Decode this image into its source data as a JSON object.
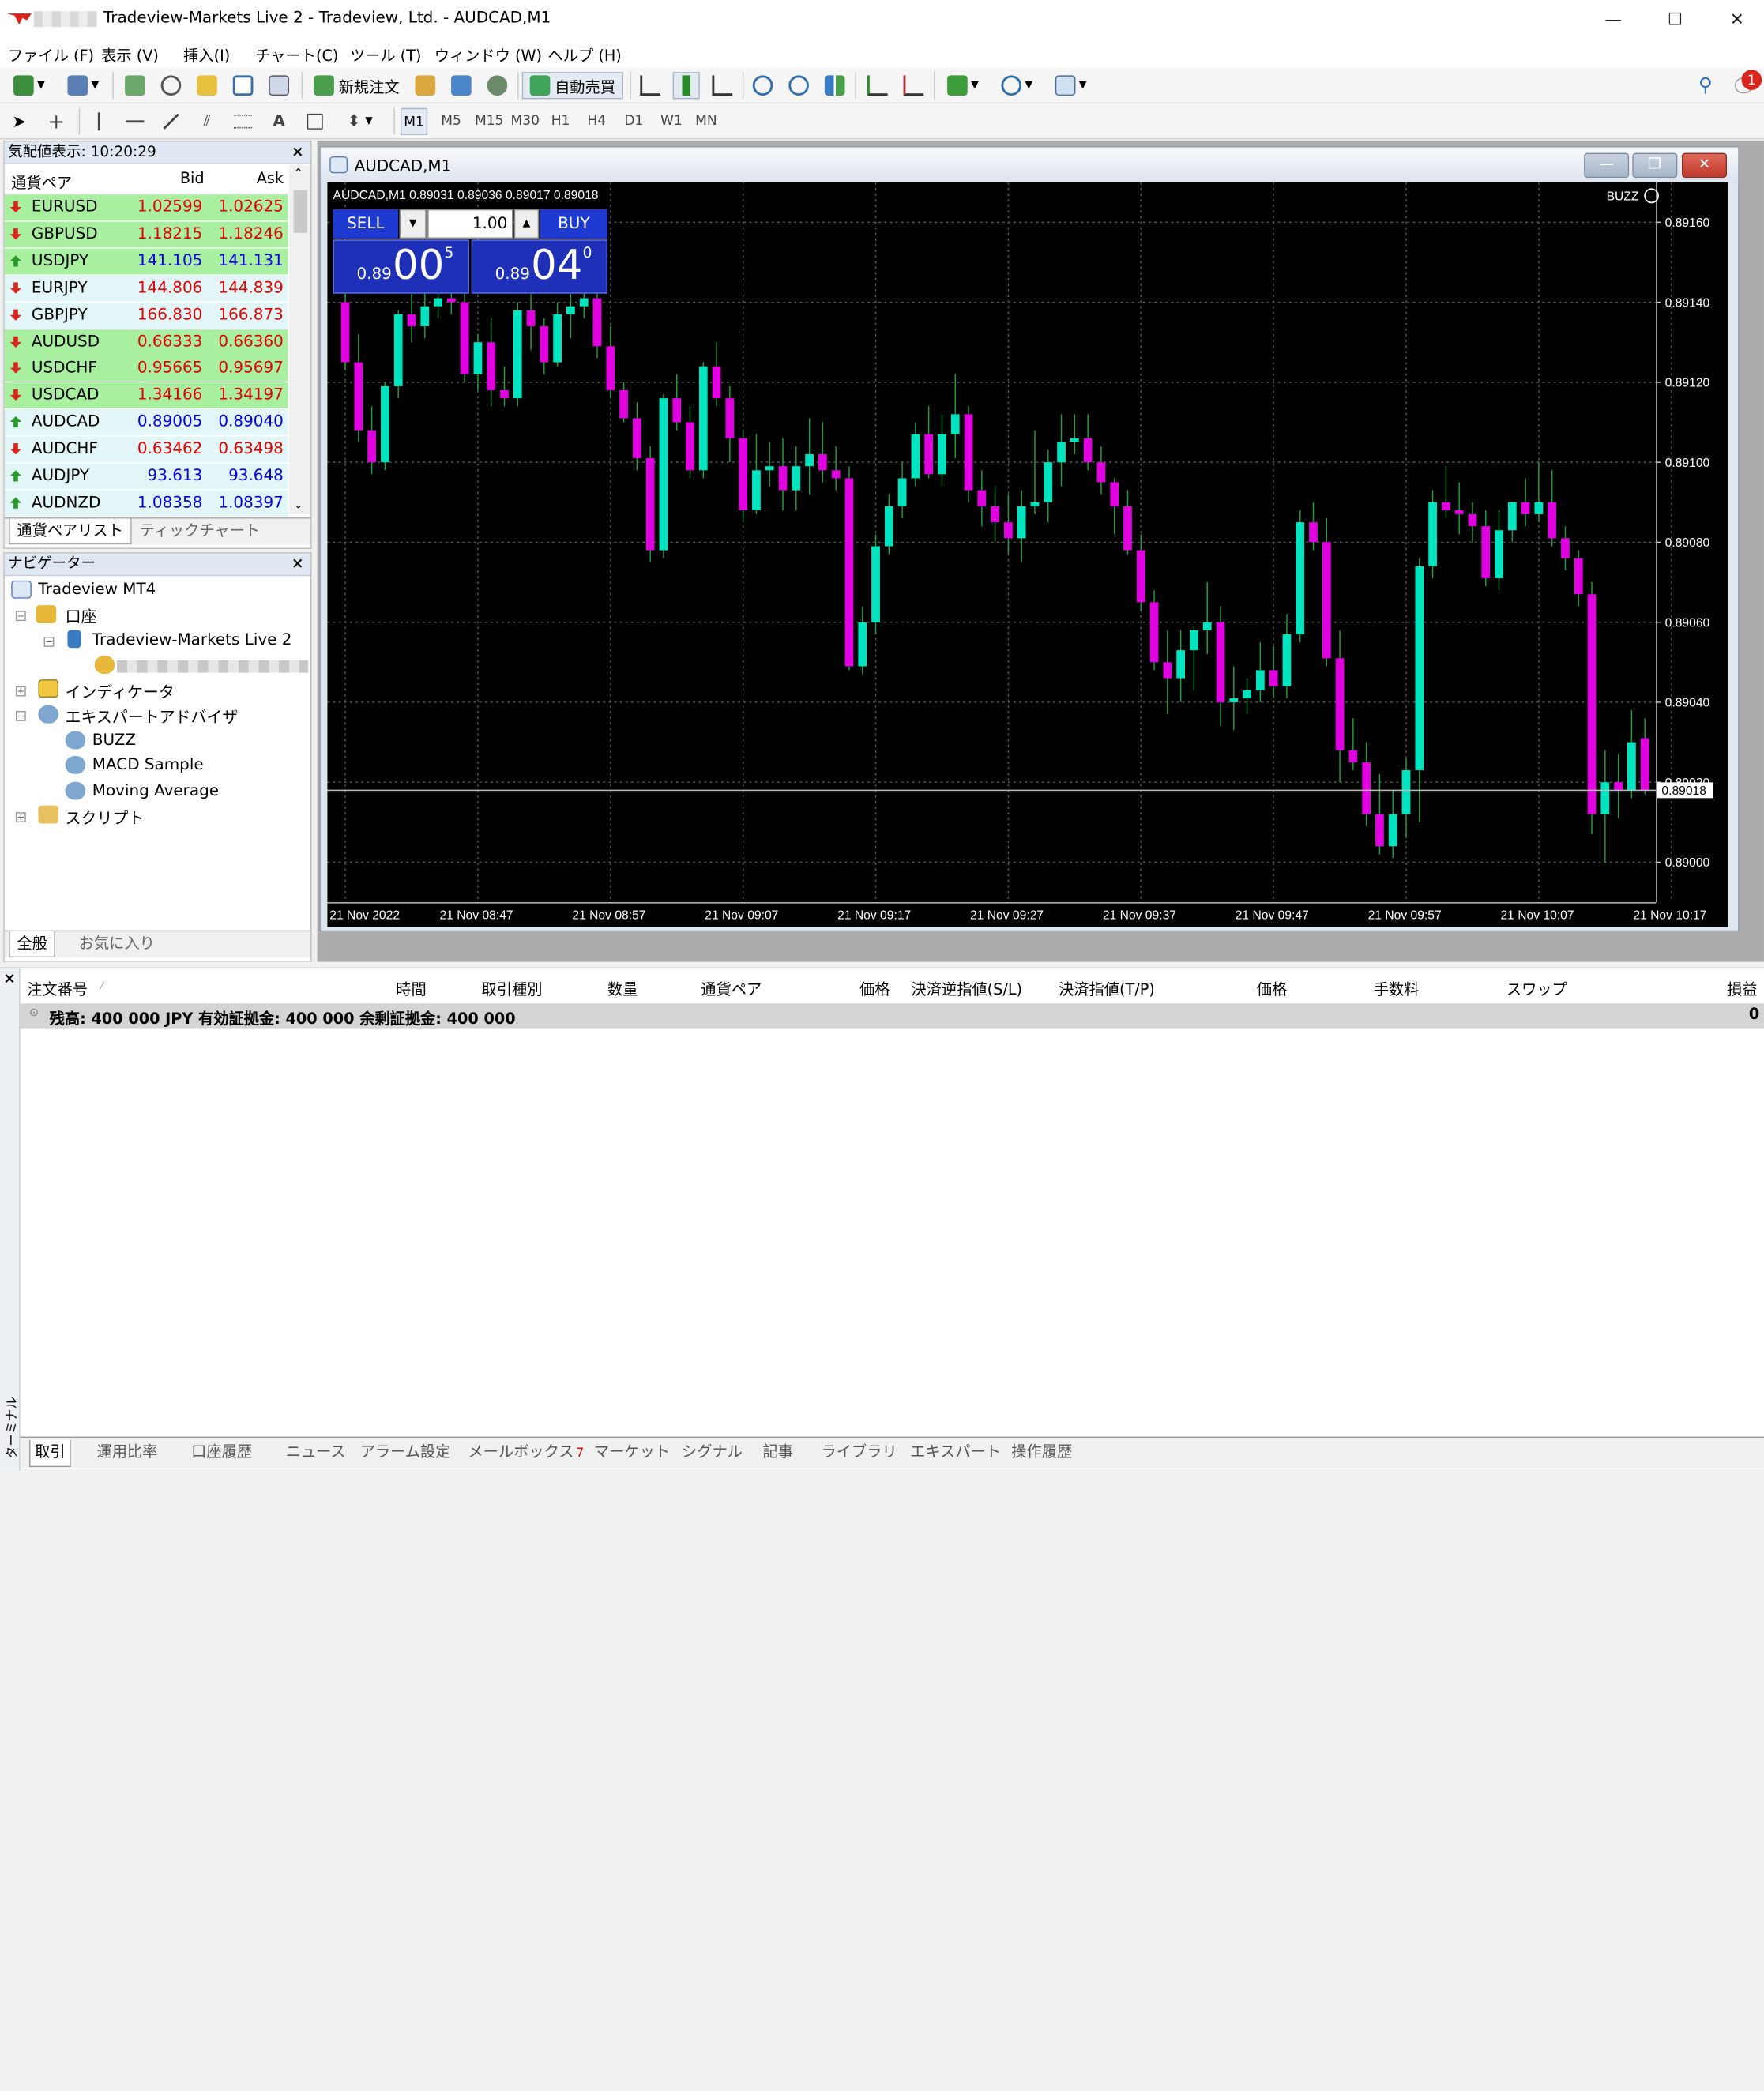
{
  "window": {
    "title": "Tradeview-Markets Live 2 - Tradeview, Ltd. - AUDCAD,M1",
    "minimize": "—",
    "maximize": "☐",
    "close": "✕"
  },
  "menu": [
    "ファイル (F)",
    "表示 (V)",
    "挿入(I)",
    "チャート(C)",
    "ツール (T)",
    "ウィンドウ (W)",
    "ヘルプ (H)"
  ],
  "toolbar": {
    "new_order": "新規注文",
    "auto_trading": "自動売買",
    "notifications": "1"
  },
  "drawbar": {
    "text_tool": "A",
    "timeframes": [
      "M1",
      "M5",
      "M15",
      "M30",
      "H1",
      "H4",
      "D1",
      "W1",
      "MN"
    ]
  },
  "market_watch": {
    "title": "気配値表示: 10:20:29",
    "close": "×",
    "col_symbol": "通貨ペア",
    "col_bid": "Bid",
    "col_ask": "Ask",
    "rows": [
      {
        "symbol": "EURUSD",
        "bid": "1.02599",
        "ask": "1.02625"
      },
      {
        "symbol": "GBPUSD",
        "bid": "1.18215",
        "ask": "1.18246"
      },
      {
        "symbol": "USDJPY",
        "bid": "141.105",
        "ask": "141.131"
      },
      {
        "symbol": "EURJPY",
        "bid": "144.806",
        "ask": "144.839"
      },
      {
        "symbol": "GBPJPY",
        "bid": "166.830",
        "ask": "166.873"
      },
      {
        "symbol": "AUDUSD",
        "bid": "0.66333",
        "ask": "0.66360"
      },
      {
        "symbol": "USDCHF",
        "bid": "0.95665",
        "ask": "0.95697"
      },
      {
        "symbol": "USDCAD",
        "bid": "1.34166",
        "ask": "1.34197"
      },
      {
        "symbol": "AUDCAD",
        "bid": "0.89005",
        "ask": "0.89040"
      },
      {
        "symbol": "AUDCHF",
        "bid": "0.63462",
        "ask": "0.63498"
      },
      {
        "symbol": "AUDJPY",
        "bid": "93.613",
        "ask": "93.648"
      },
      {
        "symbol": "AUDNZD",
        "bid": "1.08358",
        "ask": "1.08397"
      }
    ],
    "tabs": [
      "通貨ペアリスト",
      "ティックチャート"
    ]
  },
  "navigator": {
    "title": "ナビゲーター",
    "close": "×",
    "root": "Tradeview MT4",
    "accounts": "口座",
    "server": "Tradeview-Markets Live 2",
    "indicators": "インディケータ",
    "experts": "エキスパートアドバイザ",
    "ea_items": [
      "BUZZ",
      "MACD Sample",
      "Moving Average"
    ],
    "scripts": "スクリプト",
    "tabs": [
      "全般",
      "お気に入り"
    ]
  },
  "chart_window": {
    "title": "AUDCAD,M1",
    "info": "AUDCAD,M1  0.89031 0.89036 0.89017 0.89018",
    "ea_label": "BUZZ",
    "sell": "SELL",
    "buy": "BUY",
    "lot": "1.00",
    "sell_price_small": "0.89",
    "sell_price_big": "00",
    "sell_price_sup": "5",
    "buy_price_small": "0.89",
    "buy_price_big": "04",
    "buy_price_sup": "0",
    "current_price": "0.89018"
  },
  "chart_data": {
    "type": "candlestick",
    "symbol": "AUDCAD",
    "timeframe": "M1",
    "ylim": [
      0.8899,
      0.8917
    ],
    "y_ticks": [
      "0.89160",
      "0.89140",
      "0.89120",
      "0.89100",
      "0.89080",
      "0.89060",
      "0.89040",
      "0.89020",
      "0.89000"
    ],
    "x_ticks": [
      "21 Nov 2022",
      "21 Nov 08:47",
      "21 Nov 08:57",
      "21 Nov 09:07",
      "21 Nov 09:17",
      "21 Nov 09:27",
      "21 Nov 09:37",
      "21 Nov 09:47",
      "21 Nov 09:57",
      "21 Nov 10:07",
      "21 Nov 10:17"
    ],
    "bull_color": "#00e5c0",
    "bear_color": "#e000e0",
    "candles": [
      [
        0.8914,
        0.89146,
        0.89123,
        0.89125
      ],
      [
        0.89125,
        0.89132,
        0.89105,
        0.89108
      ],
      [
        0.89108,
        0.89114,
        0.89097,
        0.891
      ],
      [
        0.891,
        0.8912,
        0.89098,
        0.89119
      ],
      [
        0.89119,
        0.89138,
        0.89116,
        0.89137
      ],
      [
        0.89137,
        0.89142,
        0.8913,
        0.89134
      ],
      [
        0.89134,
        0.89144,
        0.89131,
        0.89139
      ],
      [
        0.89139,
        0.89146,
        0.89136,
        0.89141
      ],
      [
        0.89141,
        0.89148,
        0.89137,
        0.8914
      ],
      [
        0.8914,
        0.89145,
        0.8912,
        0.89122
      ],
      [
        0.89122,
        0.89132,
        0.89118,
        0.8913
      ],
      [
        0.8913,
        0.89136,
        0.89114,
        0.89118
      ],
      [
        0.89118,
        0.89124,
        0.89114,
        0.89116
      ],
      [
        0.89116,
        0.8914,
        0.89114,
        0.89138
      ],
      [
        0.89138,
        0.89142,
        0.89128,
        0.89134
      ],
      [
        0.89134,
        0.89136,
        0.89122,
        0.89125
      ],
      [
        0.89125,
        0.8914,
        0.89124,
        0.89137
      ],
      [
        0.89137,
        0.89142,
        0.89131,
        0.89139
      ],
      [
        0.89139,
        0.89145,
        0.89136,
        0.89141
      ],
      [
        0.89141,
        0.89143,
        0.89126,
        0.89129
      ],
      [
        0.89129,
        0.89134,
        0.89116,
        0.89118
      ],
      [
        0.89118,
        0.8912,
        0.8911,
        0.89111
      ],
      [
        0.89111,
        0.89115,
        0.89098,
        0.89101
      ],
      [
        0.89101,
        0.89104,
        0.89075,
        0.89078
      ],
      [
        0.89078,
        0.89117,
        0.89076,
        0.89116
      ],
      [
        0.89116,
        0.89122,
        0.89108,
        0.8911
      ],
      [
        0.8911,
        0.89114,
        0.89096,
        0.89098
      ],
      [
        0.89098,
        0.89125,
        0.89096,
        0.89124
      ],
      [
        0.89124,
        0.8913,
        0.89114,
        0.89116
      ],
      [
        0.89116,
        0.89119,
        0.891,
        0.89106
      ],
      [
        0.89106,
        0.89108,
        0.89085,
        0.89088
      ],
      [
        0.89088,
        0.89107,
        0.89087,
        0.89098
      ],
      [
        0.89098,
        0.89105,
        0.89094,
        0.89099
      ],
      [
        0.89099,
        0.89106,
        0.89088,
        0.89093
      ],
      [
        0.89093,
        0.89104,
        0.89088,
        0.89099
      ],
      [
        0.89099,
        0.89111,
        0.89092,
        0.89102
      ],
      [
        0.89102,
        0.8911,
        0.89095,
        0.89098
      ],
      [
        0.89098,
        0.89104,
        0.89093,
        0.89096
      ],
      [
        0.89096,
        0.89099,
        0.89048,
        0.89049
      ],
      [
        0.89049,
        0.89064,
        0.89047,
        0.8906
      ],
      [
        0.8906,
        0.89082,
        0.89057,
        0.89079
      ],
      [
        0.89079,
        0.89092,
        0.89077,
        0.89089
      ],
      [
        0.89089,
        0.891,
        0.89086,
        0.89096
      ],
      [
        0.89096,
        0.8911,
        0.89094,
        0.89107
      ],
      [
        0.89107,
        0.89114,
        0.89096,
        0.89097
      ],
      [
        0.89097,
        0.89112,
        0.89094,
        0.89107
      ],
      [
        0.89107,
        0.89122,
        0.89101,
        0.89112
      ],
      [
        0.89112,
        0.89114,
        0.8909,
        0.89093
      ],
      [
        0.89093,
        0.89098,
        0.89084,
        0.89089
      ],
      [
        0.89089,
        0.89094,
        0.8908,
        0.89085
      ],
      [
        0.89085,
        0.89092,
        0.89077,
        0.89081
      ],
      [
        0.89081,
        0.89093,
        0.89075,
        0.89089
      ],
      [
        0.89089,
        0.89108,
        0.89087,
        0.8909
      ],
      [
        0.8909,
        0.89103,
        0.89085,
        0.891
      ],
      [
        0.891,
        0.89112,
        0.89094,
        0.89105
      ],
      [
        0.89105,
        0.89112,
        0.89102,
        0.89106
      ],
      [
        0.89106,
        0.89112,
        0.89098,
        0.891
      ],
      [
        0.891,
        0.89104,
        0.89092,
        0.89095
      ],
      [
        0.89095,
        0.89096,
        0.89082,
        0.89089
      ],
      [
        0.89089,
        0.89093,
        0.89077,
        0.89078
      ],
      [
        0.89078,
        0.89082,
        0.89063,
        0.89065
      ],
      [
        0.89065,
        0.89068,
        0.89048,
        0.8905
      ],
      [
        0.8905,
        0.89058,
        0.89037,
        0.89046
      ],
      [
        0.89046,
        0.89058,
        0.8904,
        0.89053
      ],
      [
        0.89053,
        0.89059,
        0.89043,
        0.89058
      ],
      [
        0.89058,
        0.8907,
        0.89052,
        0.8906
      ],
      [
        0.8906,
        0.89064,
        0.89034,
        0.8904
      ],
      [
        0.8904,
        0.89049,
        0.89033,
        0.89041
      ],
      [
        0.89041,
        0.89046,
        0.89037,
        0.89043
      ],
      [
        0.89043,
        0.89055,
        0.8904,
        0.89048
      ],
      [
        0.89048,
        0.89054,
        0.89041,
        0.89044
      ],
      [
        0.89044,
        0.89062,
        0.89041,
        0.89057
      ],
      [
        0.89057,
        0.89088,
        0.89055,
        0.89085
      ],
      [
        0.89085,
        0.8909,
        0.89078,
        0.8908
      ],
      [
        0.8908,
        0.89086,
        0.89049,
        0.89051
      ],
      [
        0.89051,
        0.89058,
        0.8902,
        0.89028
      ],
      [
        0.89028,
        0.89036,
        0.89023,
        0.89025
      ],
      [
        0.89025,
        0.8903,
        0.89009,
        0.89012
      ],
      [
        0.89012,
        0.89022,
        0.89002,
        0.89004
      ],
      [
        0.89004,
        0.89018,
        0.89001,
        0.89012
      ],
      [
        0.89012,
        0.89026,
        0.89006,
        0.89023
      ],
      [
        0.89023,
        0.89076,
        0.8901,
        0.89074
      ],
      [
        0.89074,
        0.89093,
        0.89071,
        0.8909
      ],
      [
        0.8909,
        0.89099,
        0.89086,
        0.89088
      ],
      [
        0.89088,
        0.89095,
        0.89082,
        0.89087
      ],
      [
        0.89087,
        0.8909,
        0.8908,
        0.89084
      ],
      [
        0.89084,
        0.89088,
        0.89069,
        0.89071
      ],
      [
        0.89071,
        0.89088,
        0.89068,
        0.89083
      ],
      [
        0.89083,
        0.8909,
        0.8908,
        0.8909
      ],
      [
        0.8909,
        0.89096,
        0.89084,
        0.89087
      ],
      [
        0.89087,
        0.891,
        0.89085,
        0.8909
      ],
      [
        0.8909,
        0.89098,
        0.89079,
        0.89081
      ],
      [
        0.89081,
        0.89084,
        0.89073,
        0.89076
      ],
      [
        0.89076,
        0.89078,
        0.89064,
        0.89067
      ],
      [
        0.89067,
        0.8907,
        0.89007,
        0.89012
      ],
      [
        0.89012,
        0.89028,
        0.89,
        0.8902
      ],
      [
        0.8902,
        0.89027,
        0.89011,
        0.89018
      ],
      [
        0.89018,
        0.89038,
        0.89016,
        0.8903
      ],
      [
        0.89031,
        0.89036,
        0.89017,
        0.89018
      ]
    ]
  },
  "terminal": {
    "side_label": "ターミナル",
    "close": "×",
    "columns": [
      "注文番号",
      "時間",
      "取引種別",
      "数量",
      "通貨ペア",
      "価格",
      "決済逆指値(S/L)",
      "決済指値(T/P)",
      "価格",
      "手数料",
      "スワップ",
      "損益"
    ],
    "balance": "残高: 400 000 JPY  有効証拠金: 400 000  余剰証拠金: 400 000",
    "profit": "0",
    "tabs": [
      "取引",
      "運用比率",
      "口座履歴",
      "ニュース",
      "アラーム設定",
      "メールボックス",
      "マーケット",
      "シグナル",
      "記事",
      "ライブラリ",
      "エキスパート",
      "操作履歴"
    ],
    "mailbox_count": "7"
  }
}
